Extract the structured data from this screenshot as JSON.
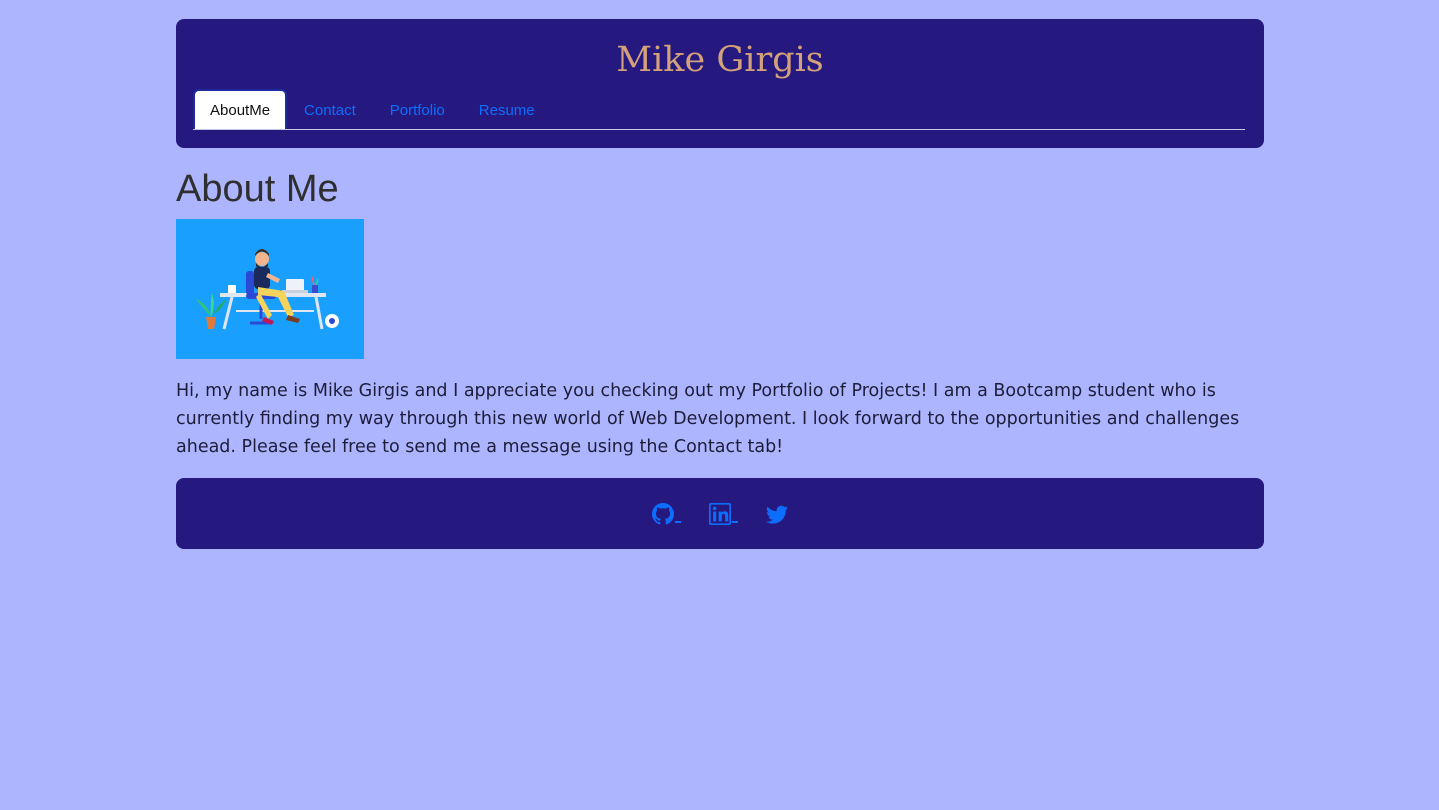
{
  "header": {
    "title": "Mike Girgis",
    "nav": [
      {
        "label": "AboutMe",
        "active": true
      },
      {
        "label": "Contact",
        "active": false
      },
      {
        "label": "Portfolio",
        "active": false
      },
      {
        "label": "Resume",
        "active": false
      }
    ]
  },
  "main": {
    "heading": "About Me",
    "image": {
      "icon": "developer-at-desk-illustration"
    },
    "bio": "Hi, my name is Mike Girgis and I appreciate you checking out my Portfolio of Projects! I am a Bootcamp student who is currently finding my way through this new world of Web Development. I look forward to the opportunities and challenges ahead. Please feel free to send me a message using the Contact tab!"
  },
  "footer": {
    "links": [
      {
        "icon": "github-icon"
      },
      {
        "icon": "linkedin-icon"
      },
      {
        "icon": "twitter-icon"
      }
    ]
  },
  "colors": {
    "page_background": "#adb5fe",
    "panel_background": "#25197f",
    "title_color": "#d4a17a",
    "link_color": "#0d6efd",
    "image_background": "#19a0ff"
  }
}
